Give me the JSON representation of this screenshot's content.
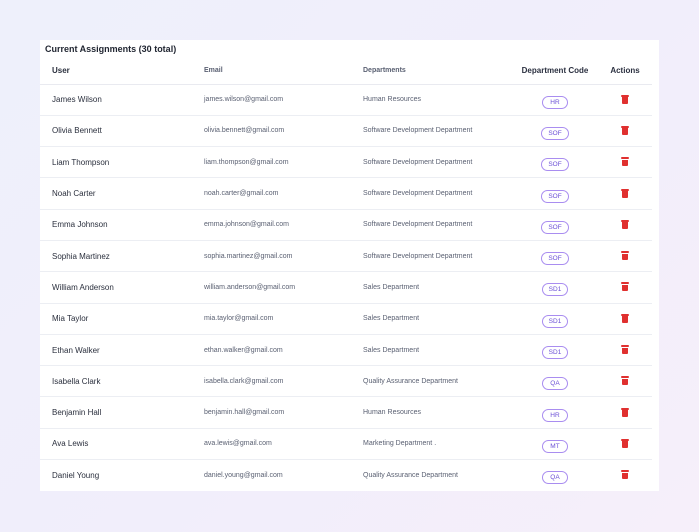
{
  "title": "Current Assignments (30 total)",
  "columns": {
    "user": "User",
    "email": "Email",
    "departments": "Departments",
    "code": "Department Code",
    "actions": "Actions"
  },
  "delete_icon": "trash-icon",
  "accent_color": "#6b4fd6",
  "delete_color": "#e0302f",
  "rows": [
    {
      "user": "James Wilson",
      "email": "james.wilson@gmail.com",
      "department": "Human Resources",
      "code": "HR"
    },
    {
      "user": "Olivia Bennett",
      "email": "olivia.bennett@gmail.com",
      "department": "Software Development Department",
      "code": "SOF"
    },
    {
      "user": "Liam Thompson",
      "email": "liam.thompson@gmail.com",
      "department": "Software Development Department",
      "code": "SOF"
    },
    {
      "user": "Noah Carter",
      "email": "noah.carter@gmail.com",
      "department": "Software Development Department",
      "code": "SOF"
    },
    {
      "user": "Emma Johnson",
      "email": "emma.johnson@gmail.com",
      "department": "Software Development Department",
      "code": "SOF"
    },
    {
      "user": "Sophia Martinez",
      "email": "sophia.martinez@gmail.com",
      "department": "Software Development Department",
      "code": "SOF"
    },
    {
      "user": "William Anderson",
      "email": "william.anderson@gmail.com",
      "department": "Sales Department",
      "code": "SD1"
    },
    {
      "user": "Mia Taylor",
      "email": "mia.taylor@gmail.com",
      "department": "Sales Department",
      "code": "SD1"
    },
    {
      "user": "Ethan Walker",
      "email": "ethan.walker@gmail.com",
      "department": "Sales Department",
      "code": "SD1"
    },
    {
      "user": "Isabella Clark",
      "email": "isabella.clark@gmail.com",
      "department": "Quality Assurance Department",
      "code": "QA"
    },
    {
      "user": "Benjamin Hall",
      "email": "benjamin.hall@gmail.com",
      "department": "Human Resources",
      "code": "HR"
    },
    {
      "user": "Ava Lewis",
      "email": "ava.lewis@gmail.com",
      "department": "Marketing Department .",
      "code": "MT"
    },
    {
      "user": "Daniel Young",
      "email": "daniel.young@gmail.com",
      "department": "Quality Assurance Department",
      "code": "QA"
    }
  ]
}
